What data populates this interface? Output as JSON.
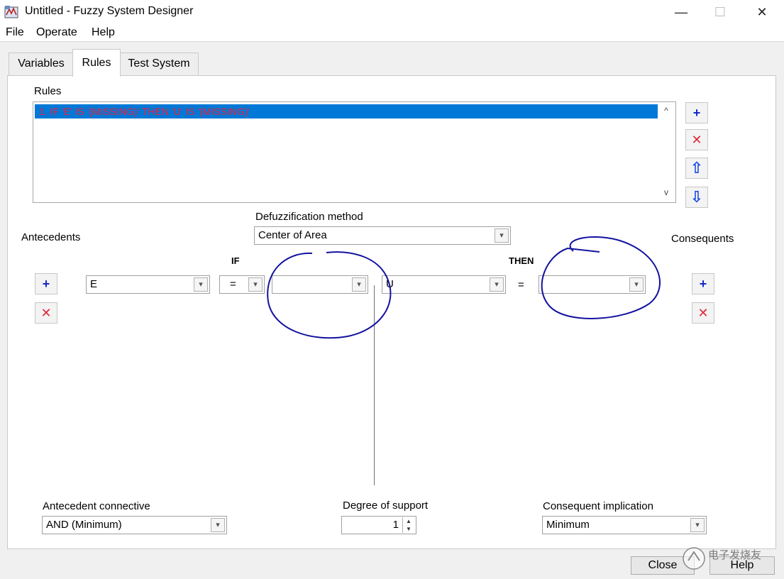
{
  "window": {
    "title": "Untitled - Fuzzy System Designer",
    "minimize_glyph": "—",
    "maximize_glyph": "☐",
    "close_glyph": "✕"
  },
  "menu": [
    "File",
    "Operate",
    "Help"
  ],
  "tabs": [
    {
      "label": "Variables",
      "active": false
    },
    {
      "label": "Rules",
      "active": true
    },
    {
      "label": "Test System",
      "active": false
    }
  ],
  "rules": {
    "label": "Rules",
    "items": [
      "1. IF 'E' IS '(MISSING)' THEN 'U' IS '(MISSING)'"
    ]
  },
  "icons": {
    "add": "+",
    "delete": "✕",
    "up": "⇧",
    "down": "⇩",
    "dropdown": "▾",
    "scroll_up": "^",
    "scroll_down": "v",
    "spin_up": "▲",
    "spin_down": "▼"
  },
  "defuzzification": {
    "label": "Defuzzification method",
    "value": "Center of Area"
  },
  "antecedents": {
    "label": "Antecedents",
    "if_label": "IF",
    "variable": "E",
    "operator": "=",
    "value": ""
  },
  "consequents": {
    "label": "Consequents",
    "then_label": "THEN",
    "variable": "U",
    "operator": "=",
    "value": ""
  },
  "antecedent_connective": {
    "label": "Antecedent connective",
    "value": "AND (Minimum)"
  },
  "degree_of_support": {
    "label": "Degree of support",
    "value": "1"
  },
  "consequent_implication": {
    "label": "Consequent implication",
    "value": "Minimum"
  },
  "buttons": {
    "close": "Close",
    "help": "Help"
  },
  "watermark": "电子发烧友",
  "colors": {
    "selection": "#0078d7",
    "rule_text": "#e8203d",
    "annotation_ink": "#1212a0",
    "add_icon": "#1428c8",
    "delete_icon": "#e0283a"
  }
}
